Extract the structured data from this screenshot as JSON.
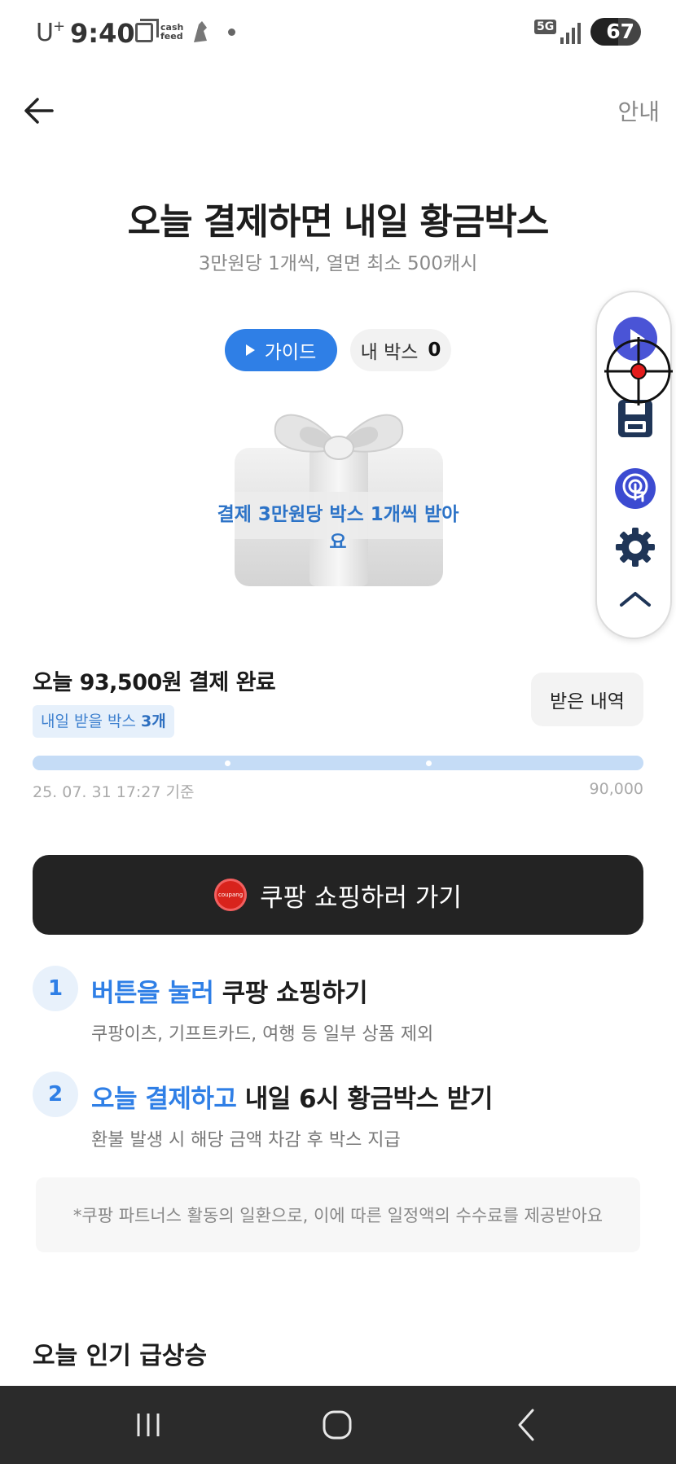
{
  "status_bar": {
    "carrier": "U",
    "carrier_sup": "+",
    "time": "9:40",
    "cashfeed": "cash\nfeed",
    "network": "5G",
    "battery": "67"
  },
  "header": {
    "guide_link": "안내"
  },
  "hero": {
    "title": "오늘 결제하면 내일 황금박스",
    "subtitle": "3만원당 1개씩, 열면 최소 500캐시",
    "guide_button": "가이드",
    "my_box_label": "내 박스",
    "my_box_count": "0",
    "gift_caption": "결제 3만원당 박스 1개씩 받아요"
  },
  "summary": {
    "title": "오늘 93,500원 결제 완료",
    "badge_prefix": "내일 받을 박스",
    "badge_count": "3개",
    "history_button": "받은 내역",
    "progress_fraction": 1.0,
    "timestamp": "25. 07. 31 17:27 기준",
    "max_label": "90,000"
  },
  "cta": {
    "logo_text": "coupang",
    "label": "쿠팡 쇼핑하러 가기"
  },
  "steps": [
    {
      "num": "1",
      "highlight": "버튼을 눌러",
      "rest": " 쿠팡 쇼핑하기",
      "desc": "쿠팡이츠, 기프트카드, 여행 등 일부 상품 제외"
    },
    {
      "num": "2",
      "highlight": "오늘 결제하고",
      "rest": " 내일 6시 황금박스 받기",
      "desc": "환불 발생 시 해당 금액 차감 후 박스 지급"
    }
  ],
  "notice": "*쿠팡 파트너스 활동의 일환으로, 이에 따른 일정액의 수수료를 제공받아요",
  "popular_title": "오늘 인기 급상승",
  "colors": {
    "accent": "#2f7fe6",
    "cta_bg": "#232323",
    "progress": "#cfe3f9",
    "coupang_red": "#d8231c"
  },
  "icons": {
    "back": "arrow-left-icon",
    "play": "play-icon",
    "save": "floppy-disk-icon",
    "touch": "touch-icon",
    "settings": "gear-icon",
    "collapse": "chevron-up-icon",
    "crosshair": "crosshair-icon"
  }
}
